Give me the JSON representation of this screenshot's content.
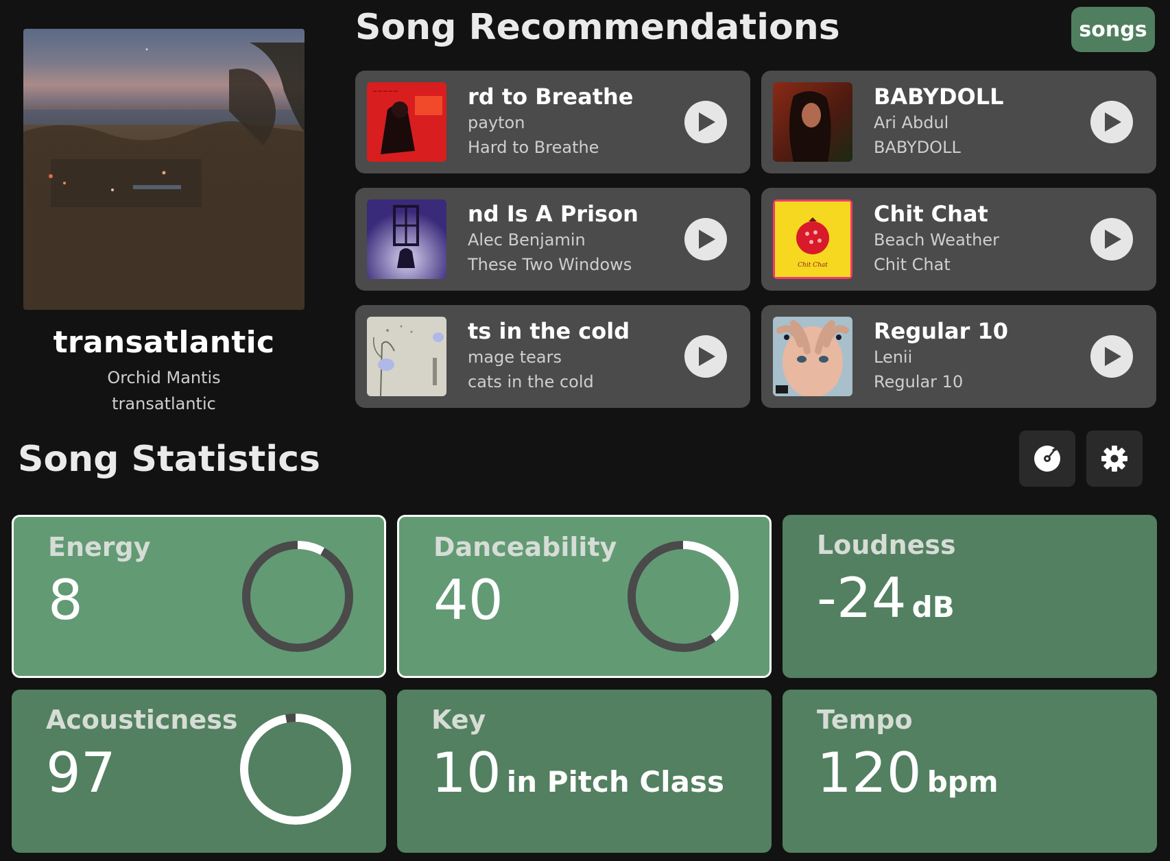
{
  "now_playing": {
    "title": "transatlantic",
    "artist": "Orchid Mantis",
    "album": "transatlantic"
  },
  "recommendations": {
    "title": "Song Recommendations",
    "songs_button": "songs",
    "items": [
      {
        "name": "rd to Breathe",
        "artist": "payton",
        "album": "Hard to Breathe"
      },
      {
        "name": "BABYDOLL",
        "artist": "Ari Abdul",
        "album": "BABYDOLL"
      },
      {
        "name": "nd Is A Prison",
        "artist": "Alec Benjamin",
        "album": "These Two Windows"
      },
      {
        "name": "Chit Chat",
        "artist": "Beach Weather",
        "album": "Chit Chat"
      },
      {
        "name": "ts in the cold",
        "artist": "mage tears",
        "album": "cats in the cold"
      },
      {
        "name": "Regular 10",
        "artist": "Lenii",
        "album": "Regular 10"
      }
    ],
    "album_art_text": {
      "chit_chat": "Chit Chat"
    }
  },
  "statistics": {
    "title": "Song Statistics",
    "cards": [
      {
        "label": "Energy",
        "value": "8",
        "unit": "",
        "level": 0.08,
        "selected": true
      },
      {
        "label": "Danceability",
        "value": "40",
        "unit": "",
        "level": 0.4,
        "selected": true
      },
      {
        "label": "Loudness",
        "value": "-24",
        "unit": "dB",
        "selected": false
      },
      {
        "label": "Acousticness",
        "value": "97",
        "unit": "",
        "level": 0.97,
        "selected": false
      },
      {
        "label": "Key",
        "value": "10",
        "unit": "in Pitch Class",
        "selected": false
      },
      {
        "label": "Tempo",
        "value": "120",
        "unit": "bpm",
        "selected": false
      }
    ]
  },
  "colors": {
    "background": "#121212",
    "card": "#4b4b4b",
    "accent": "#528060",
    "accent_selected": "#629a74"
  }
}
